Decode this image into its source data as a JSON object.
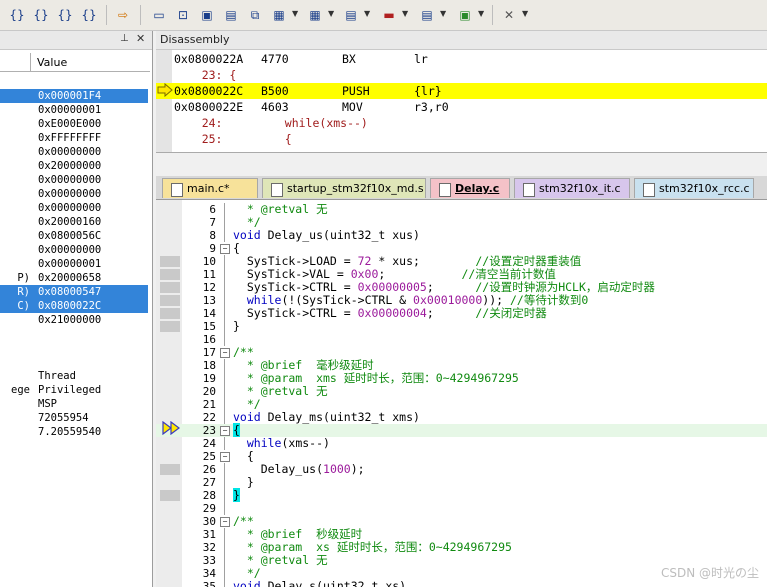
{
  "disassembly": {
    "title": "Disassembly",
    "lines": [
      {
        "addr": "0x0800022A",
        "opcode": "4770",
        "mnemonic": "BX",
        "args": "lr",
        "current": false
      },
      {
        "source": "    23: {",
        "current": false
      },
      {
        "addr": "0x0800022C",
        "opcode": "B500",
        "mnemonic": "PUSH",
        "args": "{lr}",
        "current": true
      },
      {
        "addr": "0x0800022E",
        "opcode": "4603",
        "mnemonic": "MOV",
        "args": "r3,r0",
        "current": false
      },
      {
        "source": "    24:         while(xms--)",
        "current": false
      },
      {
        "source": "    25:         {",
        "current": false
      }
    ]
  },
  "registers": {
    "column_header": "Value",
    "rows": [
      {
        "name": "",
        "value": "0x000001F4",
        "selected": true
      },
      {
        "name": "",
        "value": "0x00000001",
        "selected": false
      },
      {
        "name": "",
        "value": "0xE000E000",
        "selected": false
      },
      {
        "name": "",
        "value": "0xFFFFFFFF",
        "selected": false
      },
      {
        "name": "",
        "value": "0x00000000",
        "selected": false
      },
      {
        "name": "",
        "value": "0x20000000",
        "selected": false
      },
      {
        "name": "",
        "value": "0x00000000",
        "selected": false
      },
      {
        "name": "",
        "value": "0x00000000",
        "selected": false
      },
      {
        "name": "",
        "value": "0x00000000",
        "selected": false
      },
      {
        "name": "",
        "value": "0x20000160",
        "selected": false
      },
      {
        "name": "",
        "value": "0x0800056C",
        "selected": false
      },
      {
        "name": "",
        "value": "0x00000000",
        "selected": false
      },
      {
        "name": "",
        "value": "0x00000001",
        "selected": false
      },
      {
        "name": "P)",
        "value": "0x20000658",
        "selected": false
      },
      {
        "name": "R)",
        "value": "0x08000547",
        "selected": true
      },
      {
        "name": "C)",
        "value": "0x0800022C",
        "selected": true
      },
      {
        "name": "",
        "value": "0x21000000",
        "selected": false
      }
    ],
    "extra": [
      {
        "name": "",
        "value": "Thread"
      },
      {
        "name": "ege",
        "value": "Privileged"
      },
      {
        "name": "",
        "value": "MSP"
      },
      {
        "name": "",
        "value": "72055954"
      },
      {
        "name": "",
        "value": "7.20559540"
      }
    ]
  },
  "tabs": [
    {
      "label": "main.c*",
      "active": false,
      "color": "#f7e29a"
    },
    {
      "label": "startup_stm32f10x_md.s",
      "active": false,
      "color": "#dfe6b8"
    },
    {
      "label": "Delay.c",
      "active": true,
      "color": "#f4c2c8"
    },
    {
      "label": "stm32f10x_it.c",
      "active": false,
      "color": "#d7c6ec"
    },
    {
      "label": "stm32f10x_rcc.c",
      "active": false,
      "color": "#c9e1ef"
    }
  ],
  "code": [
    {
      "n": "6",
      "t": "  * @retval 无",
      "k": "cm"
    },
    {
      "n": "7",
      "t": "  */",
      "k": "cm"
    },
    {
      "n": "8",
      "t": "void Delay_us(uint32_t xus)",
      "k": "fn"
    },
    {
      "n": "9",
      "t": "{",
      "k": "plain",
      "fold": "-"
    },
    {
      "n": "10",
      "t": "  SysTick->LOAD = 72 * xus;",
      "k": "stmt",
      "c": "        //设置定时器重装值"
    },
    {
      "n": "11",
      "t": "  SysTick->VAL = 0x00;",
      "k": "stmt",
      "c": "           //清空当前计数值"
    },
    {
      "n": "12",
      "t": "  SysTick->CTRL = 0x00000005;",
      "k": "stmt",
      "c": "      //设置时钟源为HCLK，启动定时器"
    },
    {
      "n": "13",
      "t": "  while(!(SysTick->CTRL & 0x00010000));",
      "k": "stmt",
      "c": " //等待计数到0"
    },
    {
      "n": "14",
      "t": "  SysTick->CTRL = 0x00000004;",
      "k": "stmt",
      "c": "      //关闭定时器"
    },
    {
      "n": "15",
      "t": "}",
      "k": "plain"
    },
    {
      "n": "16",
      "t": "",
      "k": "plain"
    },
    {
      "n": "17",
      "t": "/**",
      "k": "cm",
      "fold": "-"
    },
    {
      "n": "18",
      "t": "  * @brief  毫秒级延时",
      "k": "cm"
    },
    {
      "n": "19",
      "t": "  * @param  xms 延时时长，范围：0~4294967295",
      "k": "cm"
    },
    {
      "n": "20",
      "t": "  * @retval 无",
      "k": "cm"
    },
    {
      "n": "21",
      "t": "  */",
      "k": "cm"
    },
    {
      "n": "22",
      "t": "void Delay_ms(uint32_t xms)",
      "k": "fn"
    },
    {
      "n": "23",
      "t": "{",
      "k": "plain",
      "fold": "-",
      "hl": true,
      "bracehl": true
    },
    {
      "n": "24",
      "t": "  while(xms--)",
      "k": "while"
    },
    {
      "n": "25",
      "t": "  {",
      "k": "plain",
      "fold": "-"
    },
    {
      "n": "26",
      "t": "    Delay_us(1000);",
      "k": "call"
    },
    {
      "n": "27",
      "t": "  }",
      "k": "plain"
    },
    {
      "n": "28",
      "t": "}",
      "k": "plain",
      "bracehl": true
    },
    {
      "n": "29",
      "t": "",
      "k": "plain"
    },
    {
      "n": "30",
      "t": "/**",
      "k": "cm",
      "fold": "-"
    },
    {
      "n": "31",
      "t": "  * @brief  秒级延时",
      "k": "cm"
    },
    {
      "n": "32",
      "t": "  * @param  xs 延时时长，范围：0~4294967295",
      "k": "cm"
    },
    {
      "n": "33",
      "t": "  * @retval 无",
      "k": "cm"
    },
    {
      "n": "34",
      "t": "  */",
      "k": "cm"
    },
    {
      "n": "35",
      "t": "void Delay_s(uint32_t xs)",
      "k": "fn"
    }
  ],
  "breakpoint_lines": [
    "10",
    "11",
    "12",
    "13",
    "14",
    "15",
    "23",
    "26",
    "28"
  ],
  "watermark": "CSDN @时光の尘"
}
